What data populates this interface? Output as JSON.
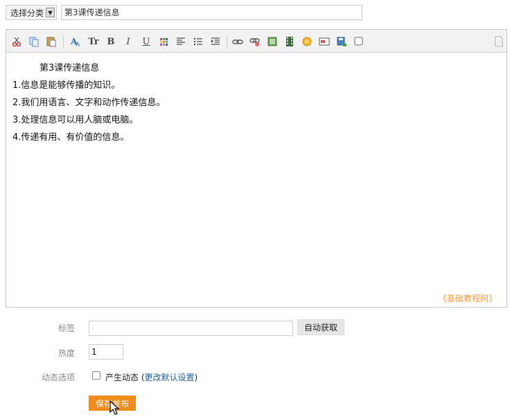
{
  "topbar": {
    "category_label": "选择分类",
    "title_value": "第3课传递信息"
  },
  "editor": {
    "content_lines": [
      "　　　第3课传递信息",
      "1.信息是能够传播的知识。",
      "2.我们用语言、文字和动作传递信息。",
      "3.处理信息可以用人脑或电脑。",
      "4.传递有用、有价值的信息。"
    ],
    "watermark": "《基础教程网》",
    "toolbar": {
      "font_size_label": "Tr",
      "bold_label": "B",
      "italic_label": "I",
      "underline_label": "U"
    }
  },
  "form": {
    "tags_label": "标签",
    "tags_value": "",
    "auto_fetch_label": "自动获取",
    "heat_label": "热度",
    "heat_value": "1",
    "dynamic_label": "动态选项",
    "dynamic_checkbox_text": "产生动态",
    "dynamic_link_open": " (",
    "dynamic_link_text": "更改默认设置",
    "dynamic_link_close": ")",
    "save_label": "保存发布"
  },
  "colors": {
    "accent": "#f08c1c",
    "link": "#1f5fa8",
    "watermark": "#f0a040"
  }
}
